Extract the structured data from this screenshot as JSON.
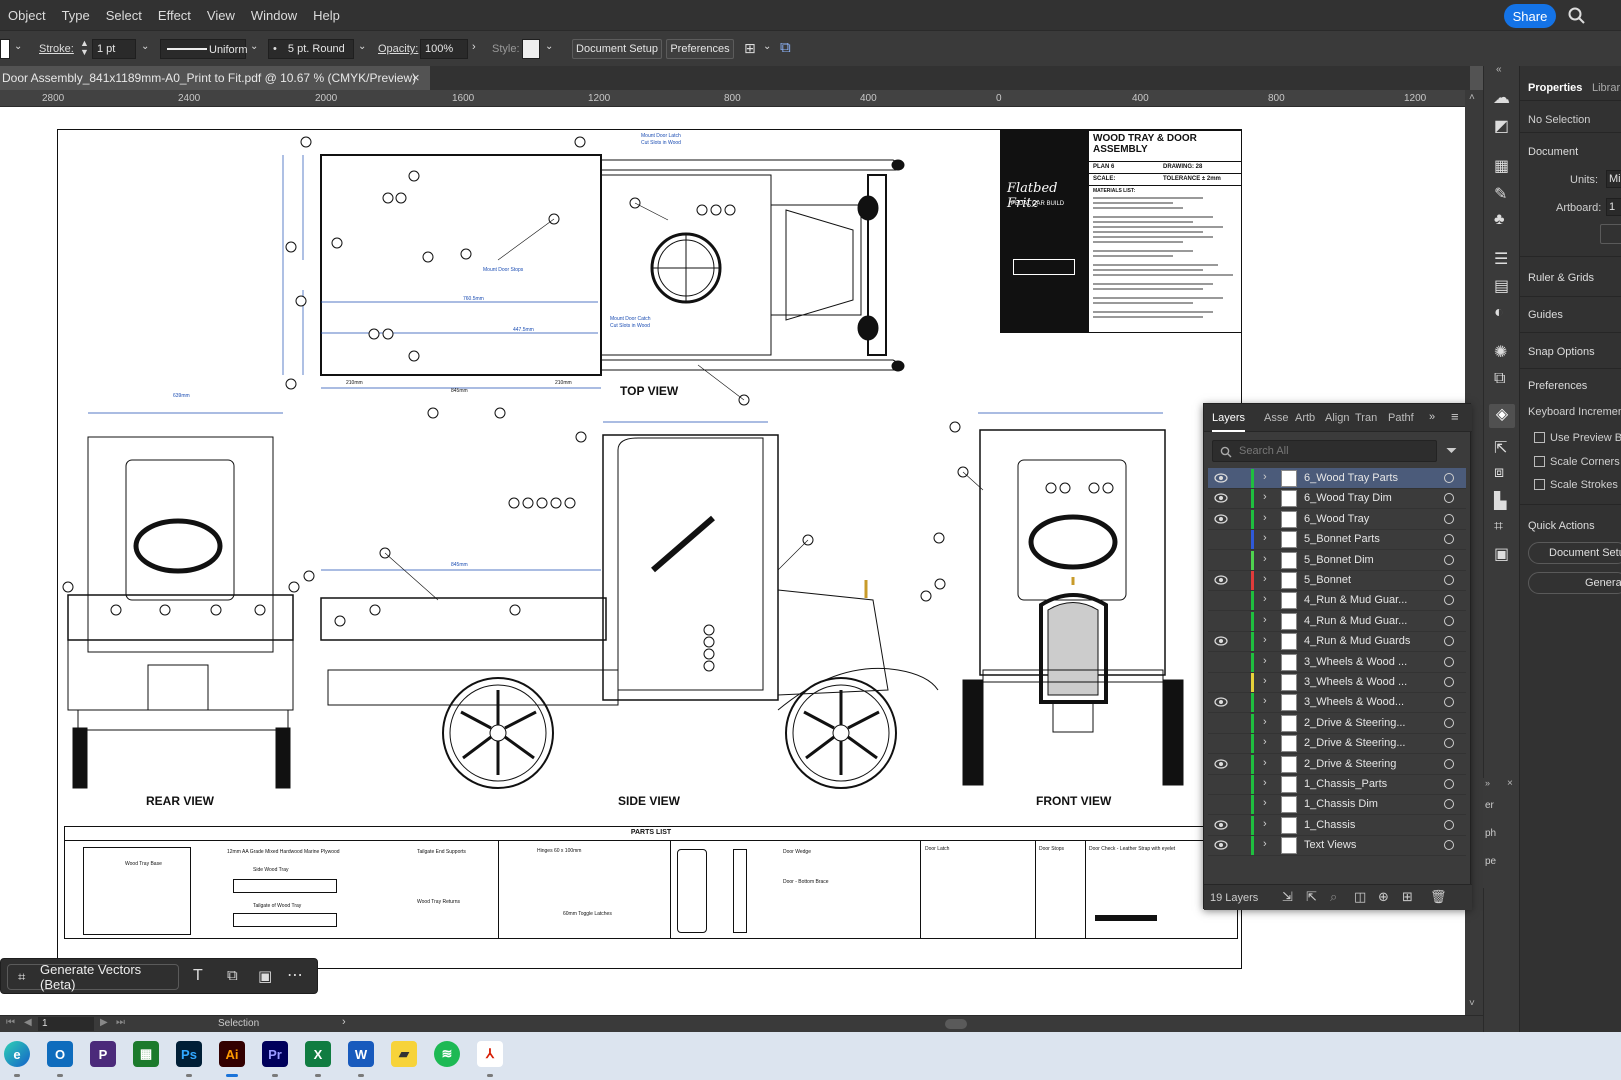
{
  "menubar": {
    "items": [
      "Object",
      "Type",
      "Select",
      "Effect",
      "View",
      "Window",
      "Help"
    ],
    "share_label": "Share"
  },
  "controlbar": {
    "stroke_label": "Stroke:",
    "stroke_weight": "1 pt",
    "stroke_profile": "Uniform",
    "brush": "5 pt. Round",
    "opacity_label": "Opacity:",
    "opacity_value": "100%",
    "style_label": "Style:",
    "document_setup": "Document Setup",
    "preferences": "Preferences"
  },
  "doctab": {
    "title": "Door Assembly_841x1189mm-A0_Print to Fit.pdf @ 10.67 % (CMYK/Preview)",
    "close": "×"
  },
  "ruler": {
    "ticks": [
      "2800",
      "2400",
      "2000",
      "1600",
      "1200",
      "800",
      "400",
      "0",
      "400",
      "800",
      "1200"
    ]
  },
  "drawing": {
    "title_block": {
      "title_line1": "WOOD TRAY & DOOR",
      "title_line2": "ASSEMBLY",
      "plan": "PLAN 6",
      "drawing": "DRAWING: 28",
      "scale": "SCALE:",
      "tolerance": "TOLERANCE ± 2mm",
      "logo_text": "Flatbed Fritz",
      "logo_sub": "PEDAL CAR BUILD",
      "materials_heading": "MATERIALS LIST:"
    },
    "views": {
      "top": "TOP VIEW",
      "rear": "REAR VIEW",
      "side": "SIDE VIEW",
      "front": "FRONT VIEW"
    },
    "parts_list_heading": "PARTS LIST",
    "annotations": {
      "mount_door_latch": "Mount Door Latch",
      "cut_slots_in_wood": "Cut Slots in Wood",
      "mount_door_stops": "Mount Door Stops",
      "mount_door_catch": "Mount Door Catch",
      "dim_760": "760.5mm",
      "dim_447": "447.5mm",
      "dim_210a": "210mm",
      "dim_845": "845mm",
      "dim_210b": "210mm",
      "dim_639": "639mm",
      "dim_845_side": "845mm"
    },
    "parts": {
      "p1": "Wood Tray Base",
      "p2": "12mm AA Grade Mixed Hardwood Marine Plywood",
      "p3": "Side Wood Tray",
      "p4": "Tailgate of Wood Tray",
      "p5": "Tailgate End Supports",
      "p6": "Wood Tray Returns",
      "p7": "Hinges 60 x 100mm",
      "p8": "60mm Toggle Latches",
      "p9": "Door Wedge",
      "p10": "Door - Bottom Brace",
      "p11": "Door Latch",
      "p12": "Door Stops",
      "p13": "Door Check - Leather Strap with eyelet"
    }
  },
  "layers_panel": {
    "tabs": [
      "Layers",
      "Asset",
      "Artb",
      "Align",
      "Tran",
      "Pathf"
    ],
    "search_placeholder": "Search All",
    "count": "19 Layers",
    "rows": [
      {
        "name": "6_Wood Tray Parts",
        "color": "#1fbf3f",
        "eye": true,
        "selected": true
      },
      {
        "name": "6_Wood Tray Dim",
        "color": "#1fbf3f",
        "eye": true,
        "selected": false
      },
      {
        "name": "6_Wood Tray",
        "color": "#1fbf3f",
        "eye": true,
        "selected": false
      },
      {
        "name": "5_Bonnet Parts",
        "color": "#2f59d8",
        "eye": false,
        "selected": false
      },
      {
        "name": "5_Bonnet Dim",
        "color": "#4fd34f",
        "eye": false,
        "selected": false
      },
      {
        "name": "5_Bonnet",
        "color": "#e03b3b",
        "eye": true,
        "selected": false
      },
      {
        "name": "4_Run & Mud Guar...",
        "color": "#1fbf3f",
        "eye": false,
        "selected": false
      },
      {
        "name": "4_Run & Mud Guar...",
        "color": "#1fbf3f",
        "eye": false,
        "selected": false
      },
      {
        "name": "4_Run & Mud Guards",
        "color": "#1fbf3f",
        "eye": true,
        "selected": false
      },
      {
        "name": "3_Wheels & Wood ...",
        "color": "#1fbf3f",
        "eye": false,
        "selected": false
      },
      {
        "name": "3_Wheels & Wood ...",
        "color": "#e6d23a",
        "eye": false,
        "selected": false
      },
      {
        "name": "3_Wheels & Wood...",
        "color": "#1fbf3f",
        "eye": true,
        "selected": false
      },
      {
        "name": "2_Drive & Steering...",
        "color": "#1fbf3f",
        "eye": false,
        "selected": false
      },
      {
        "name": "2_Drive & Steering...",
        "color": "#1fbf3f",
        "eye": false,
        "selected": false
      },
      {
        "name": "2_Drive & Steering",
        "color": "#1fbf3f",
        "eye": true,
        "selected": false
      },
      {
        "name": "1_Chassis_Parts",
        "color": "#1fbf3f",
        "eye": false,
        "selected": false
      },
      {
        "name": "1_Chassis Dim",
        "color": "#1fbf3f",
        "eye": false,
        "selected": false
      },
      {
        "name": "1_Chassis",
        "color": "#1fbf3f",
        "eye": true,
        "selected": false
      },
      {
        "name": "Text Views",
        "color": "#1fbf3f",
        "eye": true,
        "selected": false
      }
    ]
  },
  "properties": {
    "tabs": [
      "Properties",
      "Librar"
    ],
    "no_selection": "No Selection",
    "document": "Document",
    "units_label": "Units:",
    "units_value": "Mi",
    "artboard_label": "Artboard:",
    "artboard_value": "1",
    "ruler_grids": "Ruler & Grids",
    "guides": "Guides",
    "snap_options": "Snap Options",
    "preferences": "Preferences",
    "keyboard_increment": "Keyboard Increment",
    "use_preview_bounds": "Use Preview Bou",
    "scale_corners": "Scale Corners",
    "scale_strokes": "Scale Strokes &",
    "quick_actions": "Quick Actions",
    "document_setup": "Document Setu",
    "general": "Genera"
  },
  "minipanel": {
    "items": [
      "er",
      "ph",
      "pe"
    ]
  },
  "generate": {
    "label": "Generate Vectors (Beta)"
  },
  "statusbar": {
    "artboard_num": "1",
    "tool": "Selection"
  },
  "taskbar": {
    "apps": [
      "Edge",
      "Outlook",
      "Publisher",
      "Camtasia",
      "Photoshop",
      "Illustrator",
      "Premiere",
      "Excel",
      "Word",
      "Sticky Notes",
      "Spotify",
      "Acrobat"
    ]
  }
}
